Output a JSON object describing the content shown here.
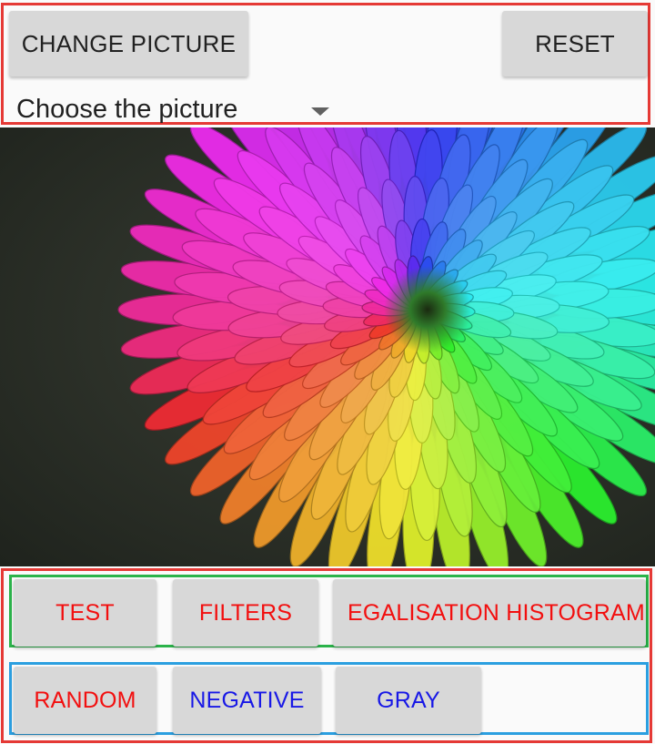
{
  "top": {
    "change_picture_label": "CHANGE PICTURE",
    "reset_label": "RESET",
    "spinner": {
      "selected": "Choose the picture"
    }
  },
  "image": {
    "subject": "rainbow-colored chrysanthemum flower"
  },
  "actions_row_1": [
    {
      "label": "TEST",
      "color": "#f20f0f"
    },
    {
      "label": "FILTERS",
      "color": "#f20f0f"
    },
    {
      "label": "EGALISATION HISTOGRAM",
      "color": "#f20f0f"
    }
  ],
  "actions_row_2": [
    {
      "label": "RANDOM",
      "color": "#f20f0f"
    },
    {
      "label": "NEGATIVE",
      "color": "#1818e6"
    },
    {
      "label": "GRAY",
      "color": "#1818e6"
    }
  ],
  "colors": {
    "panel_border_outer": "#e53935",
    "panel_border_row1": "#2bb34a",
    "panel_border_row2": "#2b9fe0",
    "button_bg": "#d8d8d8"
  }
}
